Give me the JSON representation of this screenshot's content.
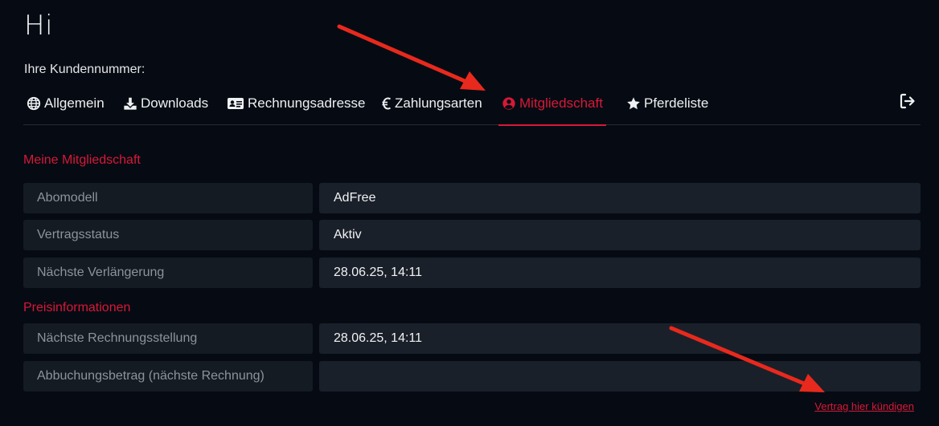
{
  "header": {
    "greeting": "Hi",
    "customer_number_label": "Ihre Kundennummer:"
  },
  "tabs": [
    {
      "label": "Allgemein",
      "icon": "globe-icon",
      "active": false
    },
    {
      "label": "Downloads",
      "icon": "download-icon",
      "active": false
    },
    {
      "label": "Rechnungsadresse",
      "icon": "id-card-icon",
      "active": false
    },
    {
      "label": "Zahlungsarten",
      "icon": "euro-icon",
      "active": false
    },
    {
      "label": "Mitgliedschaft",
      "icon": "user-circle-icon",
      "active": true
    },
    {
      "label": "Pferdeliste",
      "icon": "star-icon",
      "active": false
    }
  ],
  "logout_icon": "sign-out-icon",
  "colors": {
    "accent": "#d81838",
    "background": "#060b13",
    "label_bg": "#151b23",
    "value_bg": "#1a2029",
    "annotation_arrow": "#e8291d"
  },
  "membership": {
    "title": "Meine Mitgliedschaft",
    "rows": [
      {
        "label": "Abomodell",
        "value": "AdFree"
      },
      {
        "label": "Vertragsstatus",
        "value": "Aktiv"
      },
      {
        "label": "Nächste Verlängerung",
        "value": "28.06.25, 14:11"
      }
    ]
  },
  "pricing": {
    "title": "Preisinformationen",
    "rows": [
      {
        "label": "Nächste Rechnungsstellung",
        "value": "28.06.25, 14:11"
      },
      {
        "label": "Abbuchungsbetrag (nächste Rechnung)",
        "value": ""
      }
    ]
  },
  "cancel_link": "Vertrag hier kündigen"
}
